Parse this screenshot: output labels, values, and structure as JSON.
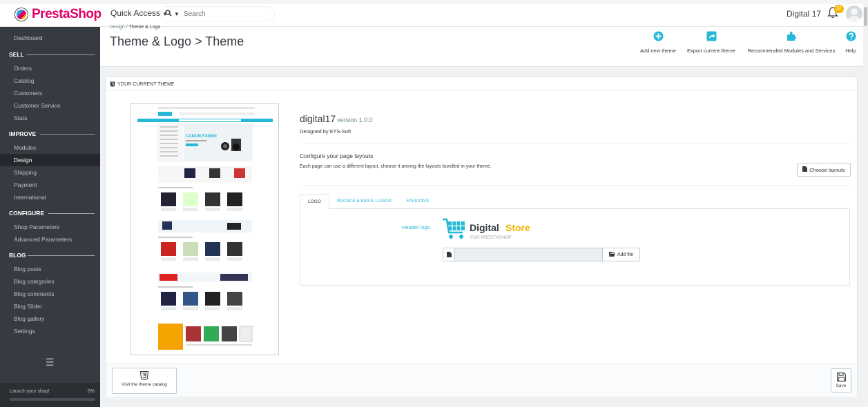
{
  "app": {
    "brand": "PrestaShop",
    "quick_access": "Quick Access",
    "search_placeholder": "Search",
    "shop_name": "Digital 17",
    "notification_count": "32"
  },
  "sidebar": {
    "dashboard": "Dashboard",
    "sections": [
      {
        "title": "SELL",
        "items": [
          "Orders",
          "Catalog",
          "Customers",
          "Customer Service",
          "Stats"
        ]
      },
      {
        "title": "IMPROVE",
        "items": [
          "Modules",
          "Design",
          "Shipping",
          "Payment",
          "International"
        ]
      },
      {
        "title": "CONFIGURE",
        "items": [
          "Shop Parameters",
          "Advanced Parameters"
        ]
      },
      {
        "title": "BLOG",
        "items": [
          "Blog posts",
          "Blog categories",
          "Blog comments",
          "Blog Slider",
          "Blog gallery",
          "Settings"
        ]
      }
    ],
    "active_item": "Design",
    "launch_text": "Launch your shop!",
    "launch_progress": "0%"
  },
  "header": {
    "breadcrumb_parent": "Design",
    "breadcrumb_separator": "/",
    "breadcrumb_current": "Theme & Logo",
    "title": "Theme & Logo > Theme",
    "toolbar": [
      {
        "label": "Add new theme",
        "icon": "plus-circle-icon"
      },
      {
        "label": "Export current theme",
        "icon": "share-icon"
      },
      {
        "label": "Recommended Modules and Services",
        "icon": "puzzle-icon"
      },
      {
        "label": "Help",
        "icon": "help-icon"
      }
    ]
  },
  "panel": {
    "heading": "YOUR CURRENT THEME",
    "theme_name": "digital17",
    "version": "version 1.0.0",
    "designed_by": "Designed by ETS-Soft",
    "configure_title": "Configure your page layouts",
    "configure_desc": "Each page can use a different layout, choose it among the layouts bundled in your theme.",
    "choose_layouts": "Choose layouts",
    "tabs": [
      "LOGO",
      "INVOICE & EMAIL LOGOS",
      "FAVICONS"
    ],
    "active_tab": "LOGO",
    "header_logo_label": "Header logo",
    "logo_main_text": "Digital",
    "logo_accent_text": "Store",
    "logo_sub_text": "FOR PRESTASHOP",
    "add_file": "Add file",
    "preview_banner": "CANON FX8000",
    "visit_catalog": "Visit the theme catalog",
    "save": "Save"
  },
  "colors": {
    "brand_pink": "#df0067",
    "accent_blue": "#25b9d7",
    "sidebar_bg": "#363a41",
    "logo_orange": "#f4b400"
  }
}
